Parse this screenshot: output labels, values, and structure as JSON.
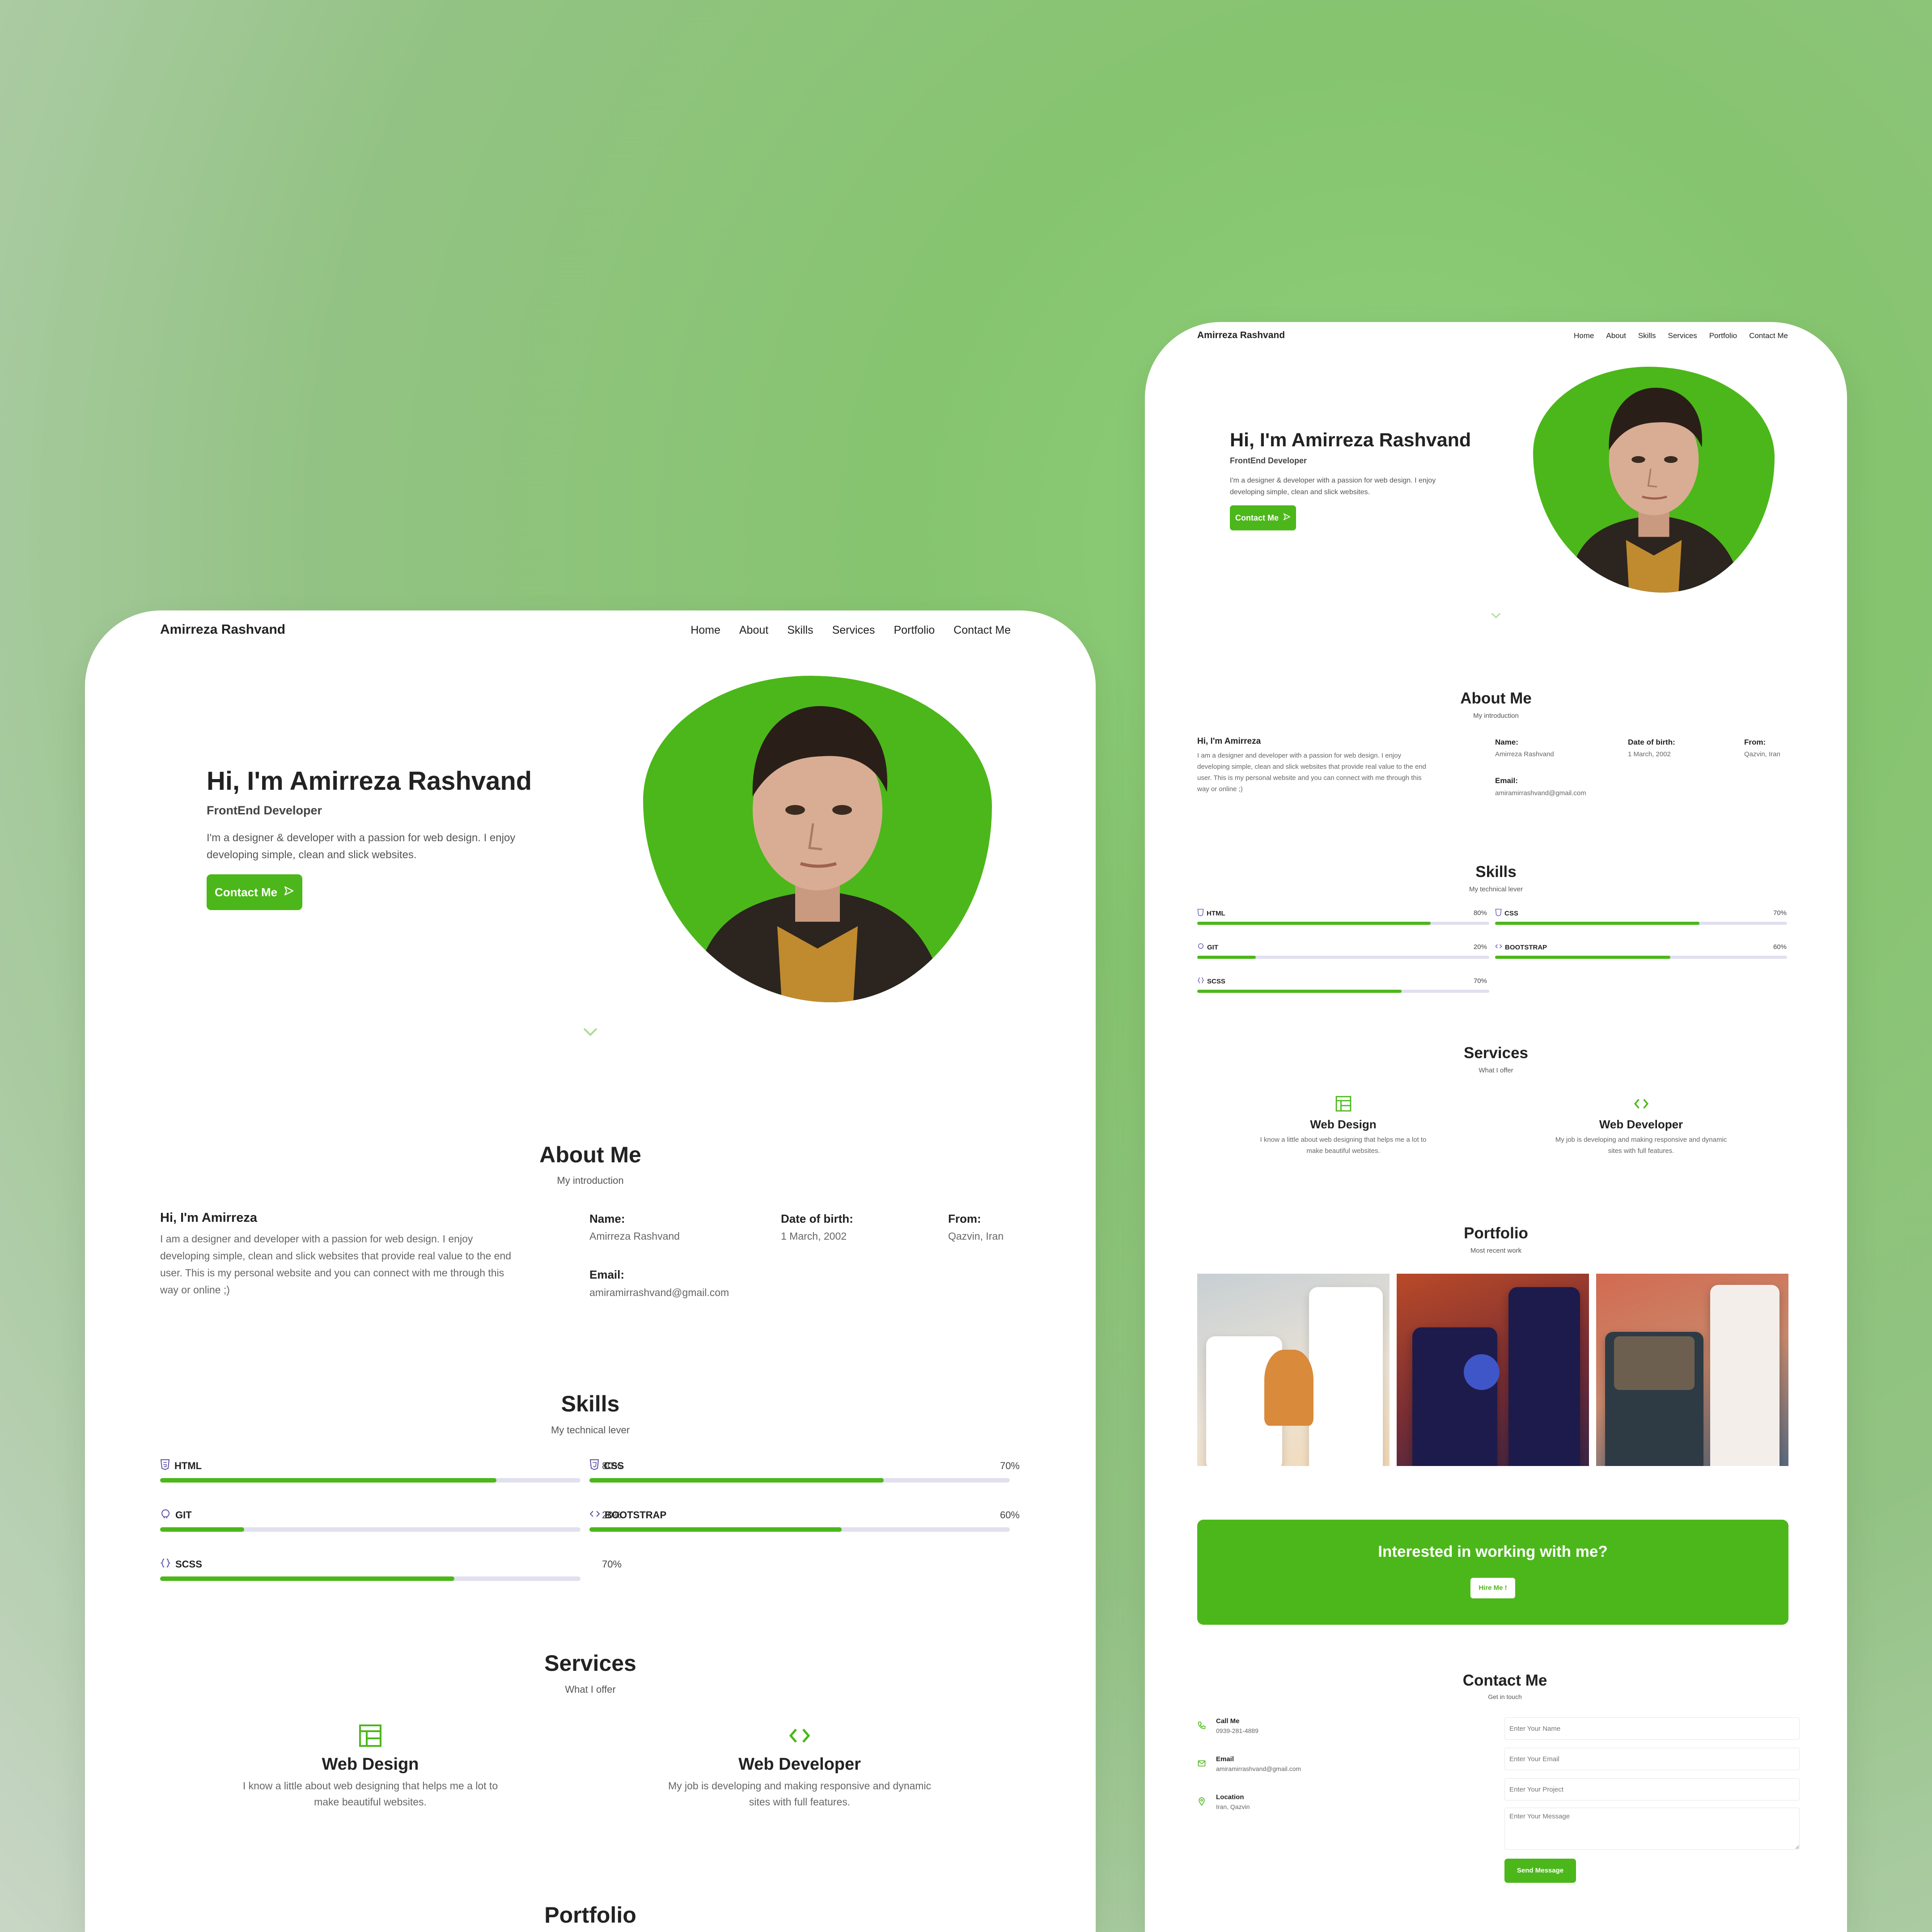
{
  "site": {
    "brand": "Amirreza Rashvand",
    "nav": [
      "Home",
      "About",
      "Skills",
      "Services",
      "Portfolio",
      "Contact Me"
    ]
  },
  "hero": {
    "title": "Hi, I'm Amirreza Rashvand",
    "subtitle": "FrontEnd Developer",
    "description_line1": "I'm a designer & developer with a passion for web design. I enjoy",
    "description_line2": "developing simple, clean and slick websites.",
    "cta": "Contact Me"
  },
  "about": {
    "title": "About Me",
    "subtitle": "My introduction",
    "greeting": "Hi, I'm Amirreza",
    "bio_line1": "I am a designer and developer with a passion for web design. I enjoy",
    "bio_line2": "developing simple, clean and slick websites that provide real value to the end",
    "bio_line3": "user. This is my personal website and you can connect with me through this",
    "bio_line4": "way or online ;)",
    "name_label": "Name:",
    "name_value": "Amirreza Rashvand",
    "dob_label": "Date of birth:",
    "dob_value": "1 March, 2002",
    "from_label": "From:",
    "from_value": "Qazvin, Iran",
    "email_label": "Email:",
    "email_value": "amiramirrashvand@gmail.com"
  },
  "skills": {
    "title": "Skills",
    "subtitle": "My technical lever",
    "items": [
      {
        "name": "HTML",
        "percent_label": "80%",
        "percent": 80
      },
      {
        "name": "CSS",
        "percent_label": "70%",
        "percent": 70
      },
      {
        "name": "GIT",
        "percent_label": "20%",
        "percent": 20
      },
      {
        "name": "BOOTSTRAP",
        "percent_label": "60%",
        "percent": 60
      },
      {
        "name": "SCSS",
        "percent_label": "70%",
        "percent": 70
      }
    ]
  },
  "services": {
    "title": "Services",
    "subtitle": "What I offer",
    "items": [
      {
        "title": "Web Design",
        "line1": "I know a little about web designing that helps me a lot to",
        "line2": "make beautiful websites."
      },
      {
        "title": "Web Developer",
        "line1": "My job is developing and making responsive and dynamic",
        "line2": "sites with full features."
      }
    ]
  },
  "portfolio": {
    "title": "Portfolio",
    "subtitle": "Most recent work"
  },
  "cta_banner": {
    "title": "Interested in working with me?",
    "button": "Hire Me !"
  },
  "contact": {
    "title": "Contact Me",
    "subtitle": "Get in touch",
    "call_label": "Call Me",
    "call_value": "0939-281-4889",
    "email_label": "Email",
    "email_value": "amiramirrashvand@gmail.com",
    "location_label": "Location",
    "location_value": "Iran, Qazvin",
    "name_placeholder": "Enter Your Name",
    "email_placeholder": "Enter Your Email",
    "project_placeholder": "Enter Your Project",
    "message_placeholder": "Enter Your Message",
    "send": "Send Message"
  },
  "colors": {
    "accent": "#4cb71a",
    "track": "#e1e0ef",
    "text": "#222222"
  }
}
